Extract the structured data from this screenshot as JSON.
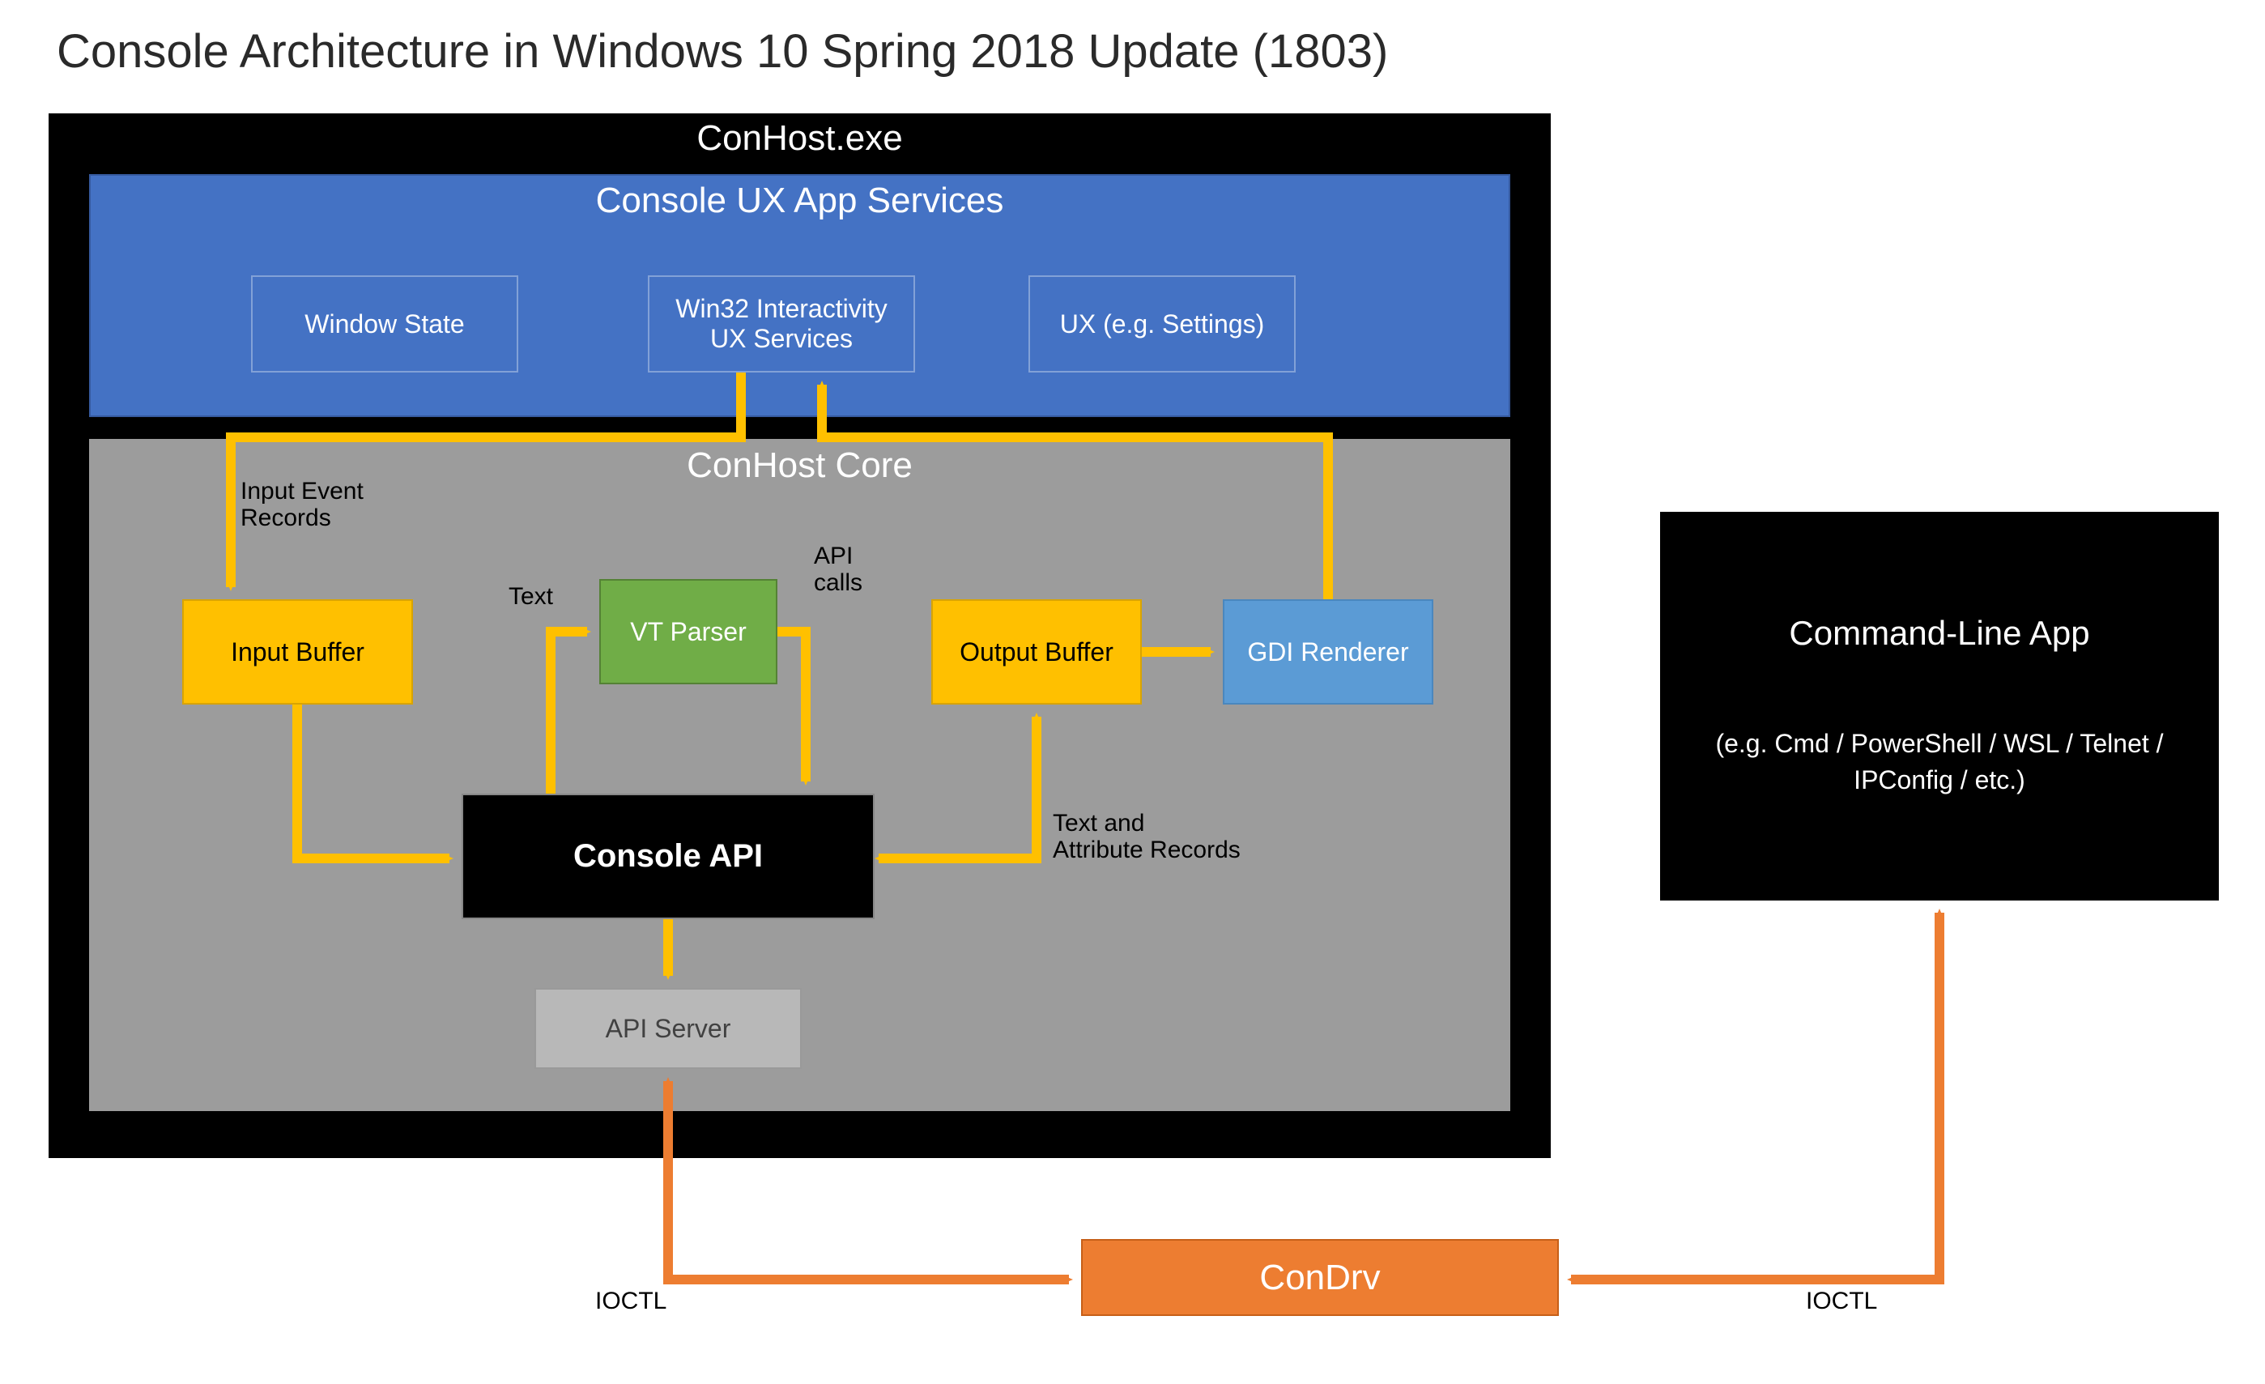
{
  "title": "Console Architecture in Windows 10 Spring 2018 Update (1803)",
  "conhost": {
    "outer_title": "ConHost.exe",
    "ux": {
      "title": "Console UX App Services",
      "window_state": "Window State",
      "win32_line1": "Win32 Interactivity",
      "win32_line2": "UX Services",
      "settings": "UX (e.g. Settings)"
    },
    "core": {
      "title": "ConHost Core",
      "input_buffer": "Input Buffer",
      "vt_parser": "VT Parser",
      "output_buffer": "Output Buffer",
      "gdi_renderer": "GDI Renderer",
      "console_api": "Console API",
      "api_server": "API Server"
    }
  },
  "condrv": "ConDrv",
  "cli": {
    "title": "Command-Line App",
    "subtitle": "(e.g. Cmd / PowerShell / WSL / Telnet / IPConfig / etc.)"
  },
  "labels": {
    "input_records": "Input Event\nRecords",
    "text": "Text",
    "api_calls": "API\ncalls",
    "text_attr": "Text and\nAttribute Records",
    "ioctl_left": "IOCTL",
    "ioctl_right": "IOCTL"
  },
  "colors": {
    "arrow": "#ffc000",
    "arrow_orange": "#ed7d31",
    "blue": "#4472c4",
    "green": "#70ad47",
    "sky": "#5b9bd5",
    "gold": "#ffc000",
    "grey": "#9c9c9c"
  }
}
